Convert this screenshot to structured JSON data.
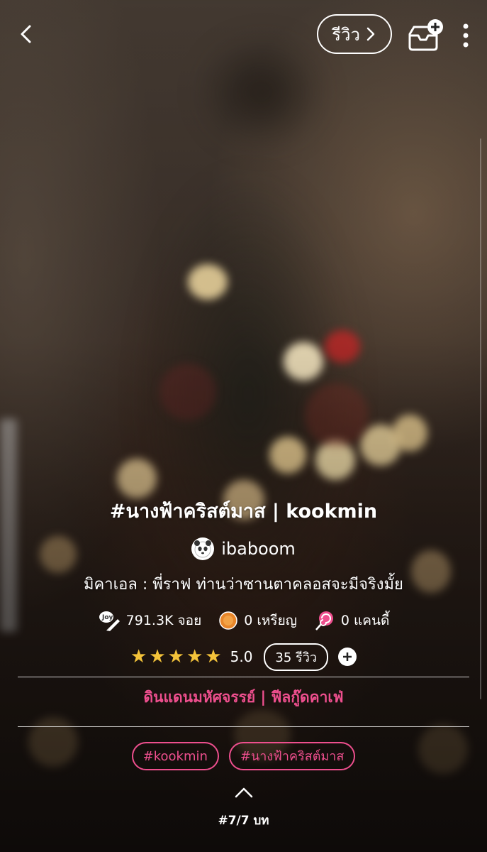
{
  "header": {
    "review_label": "รีวิว"
  },
  "story": {
    "title": "#นางฟ้าคริสต์มาส | kookmin",
    "author": "ibaboom",
    "subtitle": "มิคาเอล : พี่ราฟ ท่านว่าซานตาคลอสจะมีจริงมั้ย"
  },
  "stats": {
    "views": "791.3K จอย",
    "coins": "0 เหรียญ",
    "candy": "0 แคนดี้"
  },
  "rating": {
    "value": "5.0",
    "stars": 5,
    "review_count": "35 รีวิว"
  },
  "category": "ดินแดนมหัศจรรย์ | ฟีลกู๊ดคาเฟ่",
  "tags": [
    "#kookmin",
    "#นางฟ้าคริสต์มาส"
  ],
  "episode": "#7/7 บท",
  "colors": {
    "accent_pink": "#ee4f8e",
    "star_yellow": "#f4c33a"
  },
  "icons": [
    "back-arrow-icon",
    "chevron-right-icon",
    "add-to-shelf-icon",
    "more-vertical-icon",
    "joy-icon",
    "coin-icon",
    "candy-icon",
    "plus-icon",
    "chevron-up-icon"
  ]
}
